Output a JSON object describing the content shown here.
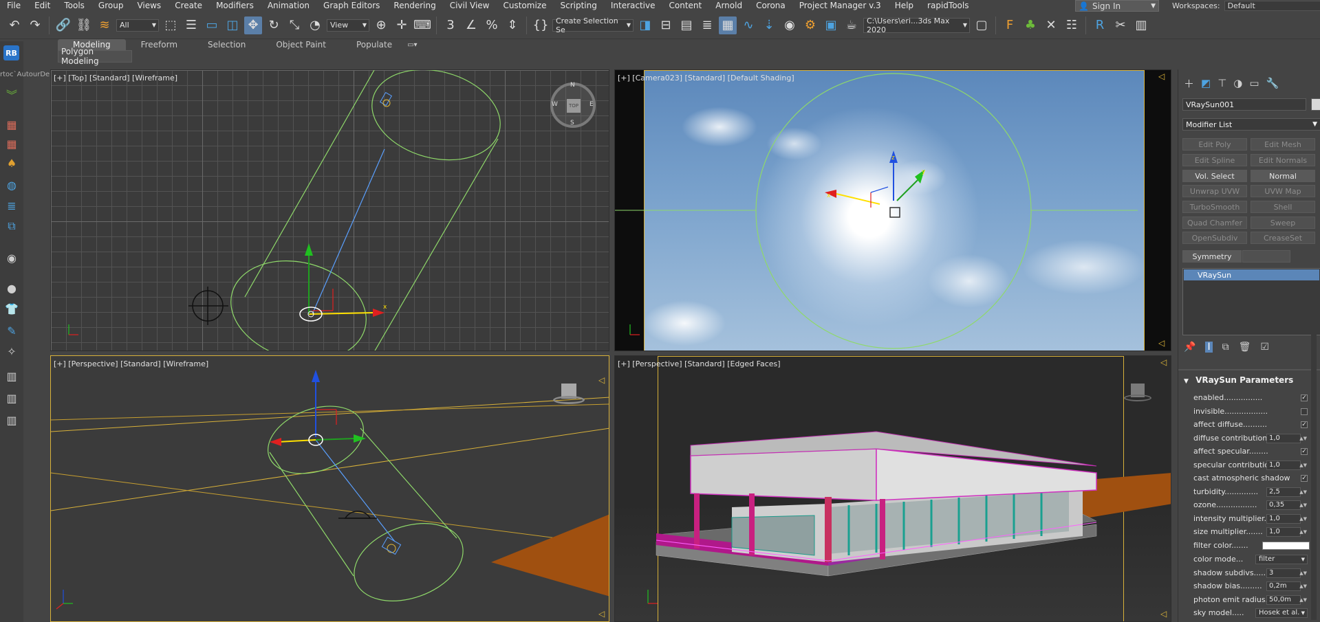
{
  "menu": [
    "File",
    "Edit",
    "Tools",
    "Group",
    "Views",
    "Create",
    "Modifiers",
    "Animation",
    "Graph Editors",
    "Rendering",
    "Civil View",
    "Customize",
    "Scripting",
    "Interactive",
    "Content",
    "Arnold",
    "Corona",
    "Project Manager v.3",
    "Help",
    "rapidTools"
  ],
  "signin": {
    "label": "Sign In"
  },
  "workspaces": {
    "label": "Workspaces:",
    "value": "Default"
  },
  "toolbar": {
    "filter_value": "All",
    "refcoord_value": "View",
    "selection_set_value": "Create Selection Se",
    "project_path_value": "C:\\Users\\eri...3ds Max 2020"
  },
  "ribbon": {
    "tabs": [
      "Modeling",
      "Freeform",
      "Selection",
      "Object Paint",
      "Populate"
    ],
    "panel_label": "Polygon Modeling"
  },
  "left": {
    "badge": "RB",
    "path_label": "rtoc`AutourDe"
  },
  "viewports": {
    "top_label": "[+] [Top] [Standard] [Wireframe]",
    "camera_label": "[+] [Camera023] [Standard] [Default Shading]",
    "persp_label": "[+] [Perspective] [Standard] [Wireframe]",
    "edged_label": "[+] [Perspective] [Standard] [Edged Faces]",
    "compass": {
      "n": "N",
      "s": "S",
      "e": "E",
      "w": "W",
      "cube_top": "TOP"
    }
  },
  "command_panel": {
    "object_name": "VRaySun001",
    "modifier_list": "Modifier List",
    "buttons": [
      [
        "Edit Poly",
        "Edit Mesh"
      ],
      [
        "Edit Spline",
        "Edit Normals"
      ],
      [
        "Vol. Select",
        "Normal"
      ],
      [
        "Unwrap UVW",
        "UVW Map"
      ],
      [
        "TurboSmooth",
        "Shell"
      ],
      [
        "Quad Chamfer",
        "Sweep"
      ],
      [
        "OpenSubdiv",
        "CreaseSet"
      ],
      [
        "Symmetry",
        ""
      ]
    ],
    "stack_item": "VRaySun",
    "params_title": "VRaySun Parameters",
    "params": {
      "enabled": {
        "label": "enabled................",
        "checked": "✓"
      },
      "invisible": {
        "label": "invisible...................",
        "checked": ""
      },
      "affect_diffuse": {
        "label": "affect diffuse................",
        "checked": "✓"
      },
      "diffuse_contribution": {
        "label": "diffuse contribution",
        "value": "1,0"
      },
      "affect_specular": {
        "label": "affect specular.............",
        "checked": "✓"
      },
      "specular_contribution": {
        "label": "specular contributio",
        "value": "1,0"
      },
      "cast_atmo": {
        "label": "cast atmospheric shadows...",
        "checked": "✓"
      },
      "turbidity": {
        "label": "turbidity..............",
        "value": "2,5"
      },
      "ozone": {
        "label": "ozone.................",
        "value": "0,35"
      },
      "intensity_multiplier": {
        "label": "intensity multiplier..",
        "value": "1,0"
      },
      "size_multiplier": {
        "label": "size multiplier.......",
        "value": "1,0"
      },
      "filter_color": {
        "label": "filter color......."
      },
      "color_mode": {
        "label": "color mode...",
        "value": "filter"
      },
      "shadow_subdivs": {
        "label": "shadow subdivs.....",
        "value": "3"
      },
      "shadow_bias": {
        "label": "shadow bias.........",
        "value": "0,2m"
      },
      "photon_emit_radius": {
        "label": "photon emit radius.",
        "value": "50,0m"
      },
      "sky_model": {
        "label": "sky model.....",
        "value": "Hosek et al."
      }
    }
  },
  "colors": {
    "accent": "#5b86b8",
    "viewport_active_border": "#d9b23a",
    "wire_green": "#8fd96a"
  }
}
